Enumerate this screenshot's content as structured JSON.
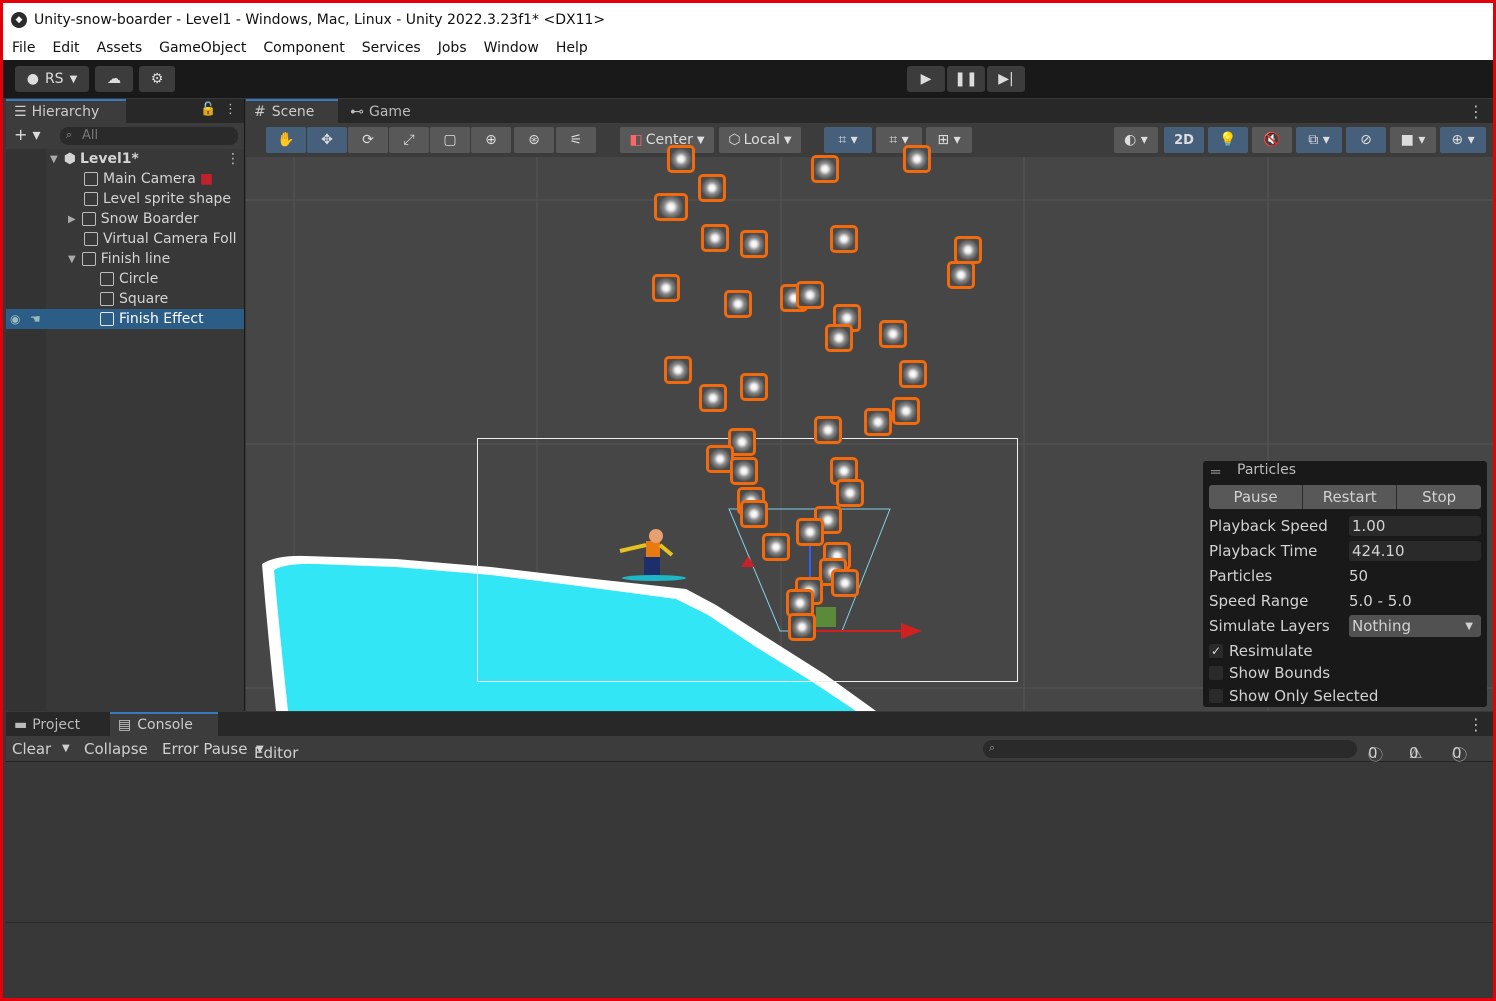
{
  "window": {
    "title": "Unity-snow-boarder - Level1 - Windows, Mac, Linux - Unity 2022.3.23f1* <DX11>"
  },
  "menu": [
    "File",
    "Edit",
    "Assets",
    "GameObject",
    "Component",
    "Services",
    "Jobs",
    "Window",
    "Help"
  ],
  "toolbar": {
    "account": "RS"
  },
  "hierarchy": {
    "tab": "Hierarchy",
    "search_placeholder": "All",
    "items": [
      {
        "label": "Level1*"
      },
      {
        "label": "Main Camera"
      },
      {
        "label": "Level sprite shape"
      },
      {
        "label": "Snow Boarder"
      },
      {
        "label": "Virtual Camera Foll"
      },
      {
        "label": "Finish line"
      },
      {
        "label": "Circle"
      },
      {
        "label": "Square"
      },
      {
        "label": "Finish Effect"
      }
    ]
  },
  "scene": {
    "tabs": [
      "Scene",
      "Game"
    ],
    "pivot": "Center",
    "space": "Local",
    "mode2d": "2D"
  },
  "particles": {
    "title": "Particles",
    "pause": "Pause",
    "restart": "Restart",
    "stop": "Stop",
    "playback_speed_label": "Playback Speed",
    "playback_speed": "1.00",
    "playback_time_label": "Playback Time",
    "playback_time": "424.10",
    "particles_label": "Particles",
    "particles": "50",
    "speed_range_label": "Speed Range",
    "speed_range": "5.0 - 5.0",
    "simulate_layers_label": "Simulate Layers",
    "simulate_layers": "Nothing",
    "resimulate": "Resimulate",
    "show_bounds": "Show Bounds",
    "show_only_selected": "Show Only Selected"
  },
  "bottom": {
    "tabs": [
      "Project",
      "Console"
    ],
    "clear": "Clear",
    "collapse": "Collapse",
    "error_pause": "Error Pause",
    "editor": "Editor",
    "count_log": "0",
    "count_warn": "0",
    "count_err": "0"
  }
}
